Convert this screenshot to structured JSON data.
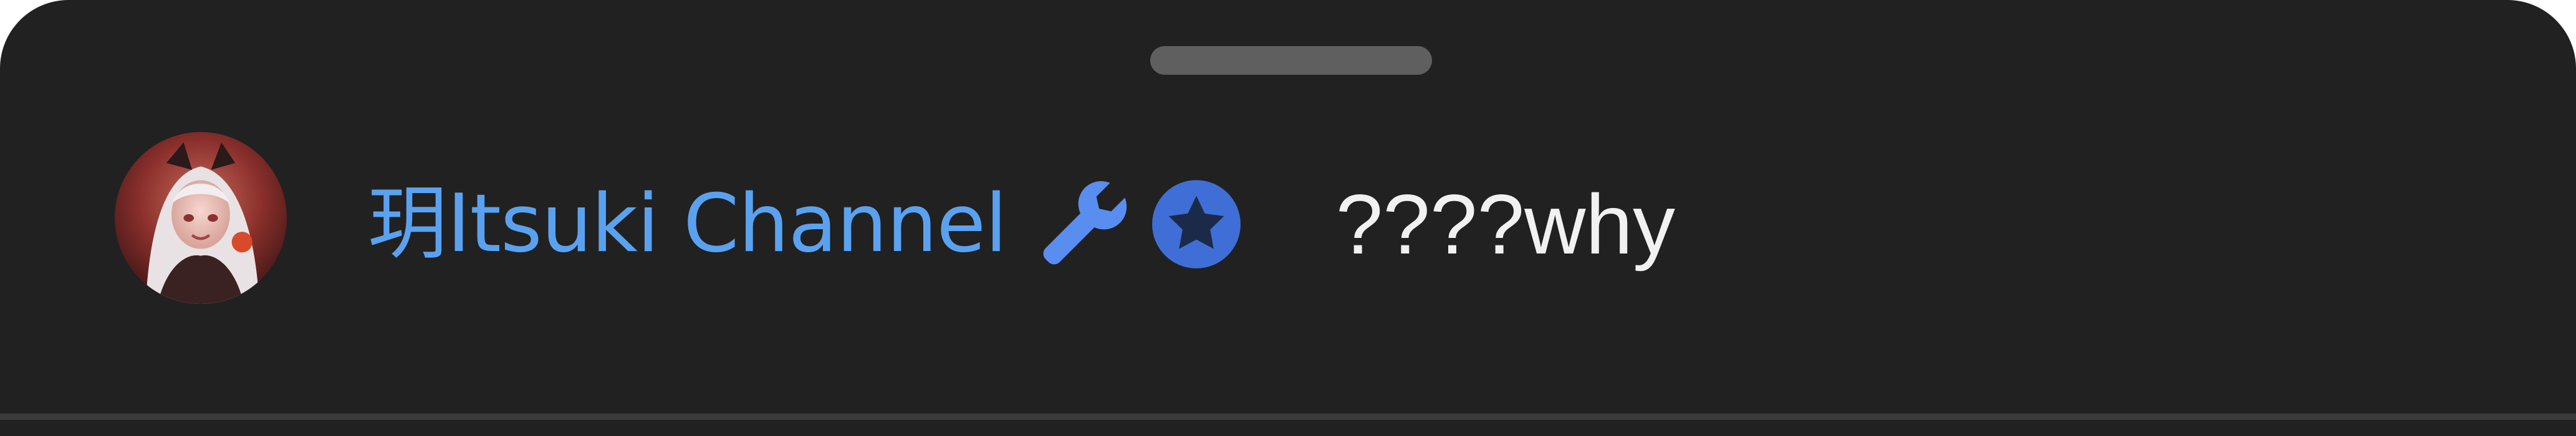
{
  "comment": {
    "author": "玥Itsuki Channel",
    "message": "????why",
    "author_color": "#5aa2f0",
    "badges": [
      {
        "name": "moderator",
        "icon": "wrench-icon",
        "color": "#5a8df0"
      },
      {
        "name": "member",
        "icon": "star-badge-icon",
        "color": "#3f6fd6"
      }
    ]
  },
  "sheet": {
    "background": "#212121",
    "handle_color": "#5f5f5f"
  }
}
